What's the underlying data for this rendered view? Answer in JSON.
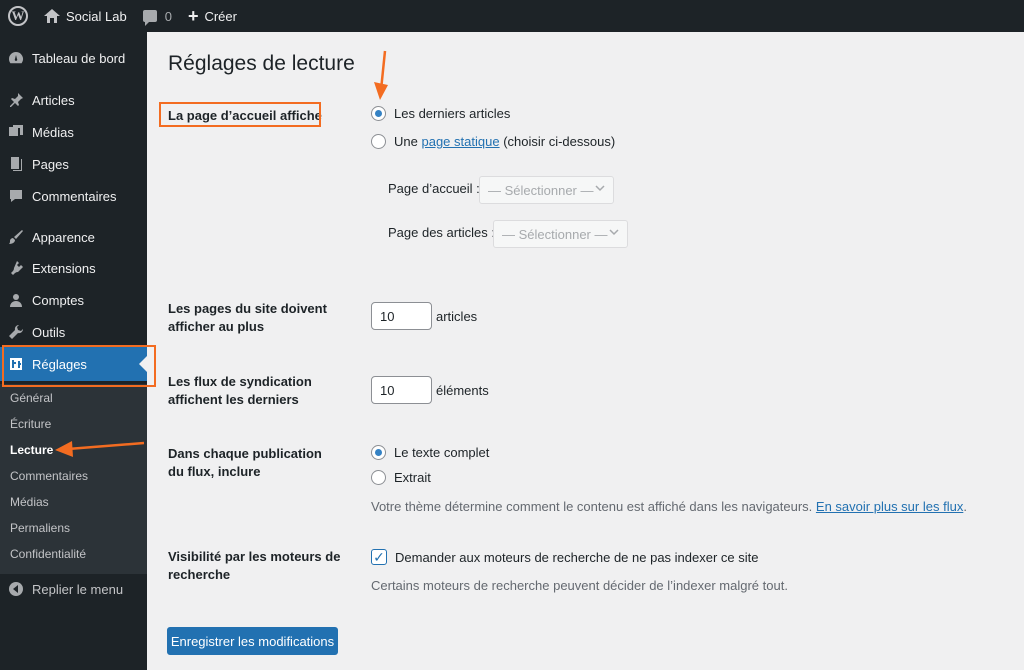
{
  "admin_bar": {
    "site_name": "Social Lab",
    "comments_count": "0",
    "new_label": "Créer"
  },
  "sidebar": {
    "items": [
      {
        "label": "Tableau de bord",
        "icon": "dashboard-icon"
      },
      {
        "label": "Articles",
        "icon": "pin-icon"
      },
      {
        "label": "Médias",
        "icon": "media-icon"
      },
      {
        "label": "Pages",
        "icon": "page-icon"
      },
      {
        "label": "Commentaires",
        "icon": "comment-icon"
      },
      {
        "label": "Apparence",
        "icon": "brush-icon"
      },
      {
        "label": "Extensions",
        "icon": "plugin-icon"
      },
      {
        "label": "Comptes",
        "icon": "user-icon"
      },
      {
        "label": "Outils",
        "icon": "wrench-icon"
      },
      {
        "label": "Réglages",
        "icon": "settings-icon"
      }
    ],
    "submenu": [
      "Général",
      "Écriture",
      "Lecture",
      "Commentaires",
      "Médias",
      "Permaliens",
      "Confidentialité"
    ],
    "collapse_label": "Replier le menu"
  },
  "page": {
    "title": "Réglages de lecture",
    "homepage_displays": {
      "label": "La page d’accueil affiche",
      "option_latest": "Les derniers articles",
      "option_static_prefix": "Une",
      "option_static_link": "page statique",
      "option_static_suffix": "(choisir ci-dessous)",
      "homepage_label": "Page d’accueil :",
      "posts_page_label": "Page des articles :",
      "select_placeholder": "— Sélectionner —"
    },
    "posts_per_page": {
      "label": "Les pages du site doivent afficher au plus",
      "value": "10",
      "unit": "articles"
    },
    "feed_items": {
      "label": "Les flux de syndication affichent les derniers",
      "value": "10",
      "unit": "éléments"
    },
    "feed_content": {
      "label": "Dans chaque publication du flux, inclure",
      "option_full": "Le texte complet",
      "option_excerpt": "Extrait",
      "description_prefix": "Votre thème détermine comment le contenu est affiché dans les navigateurs.",
      "description_link": "En savoir plus sur les flux",
      "description_suffix": "."
    },
    "search_visibility": {
      "label": "Visibilité par les moteurs de recherche",
      "checkbox_label": "Demander aux moteurs de recherche de ne pas indexer ce site",
      "description": "Certains moteurs de recherche peuvent décider de l’indexer malgré tout."
    },
    "save_label": "Enregistrer les modifications"
  },
  "colors": {
    "accent": "#2271b1",
    "annotation": "#f36c21",
    "sidebar_bg": "#1d2327"
  }
}
